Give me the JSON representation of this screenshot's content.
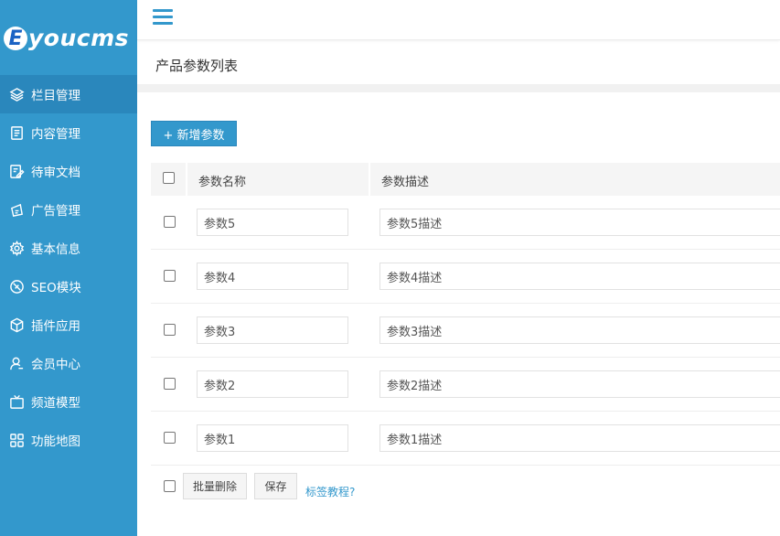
{
  "app": {
    "logo_letter": "E",
    "logo_text": "youcms"
  },
  "sidebar": {
    "items": [
      {
        "label": "栏目管理",
        "icon": "layers-icon",
        "active": true
      },
      {
        "label": "内容管理",
        "icon": "document-icon"
      },
      {
        "label": "待审文档",
        "icon": "edit-document-icon"
      },
      {
        "label": "广告管理",
        "icon": "ad-icon"
      },
      {
        "label": "基本信息",
        "icon": "gear-icon"
      },
      {
        "label": "SEO模块",
        "icon": "seo-icon"
      },
      {
        "label": "插件应用",
        "icon": "package-icon"
      },
      {
        "label": "会员中心",
        "icon": "user-icon"
      },
      {
        "label": "频道模型",
        "icon": "tv-icon"
      },
      {
        "label": "功能地图",
        "icon": "grid-icon"
      }
    ]
  },
  "page": {
    "title": "产品参数列表"
  },
  "toolbar": {
    "add_label": "+ 新增参数"
  },
  "table": {
    "columns": [
      "参数名称",
      "参数描述"
    ],
    "rows": [
      {
        "name": "参数5",
        "desc": "参数5描述"
      },
      {
        "name": "参数4",
        "desc": "参数4描述"
      },
      {
        "name": "参数3",
        "desc": "参数3描述"
      },
      {
        "name": "参数2",
        "desc": "参数2描述"
      },
      {
        "name": "参数1",
        "desc": "参数1描述"
      }
    ]
  },
  "footer": {
    "batch_delete_label": "批量删除",
    "save_label": "保存",
    "help_link": "标签教程?"
  },
  "colors": {
    "brand": "#3398cc",
    "sidebar_active": "#2a87bc"
  }
}
